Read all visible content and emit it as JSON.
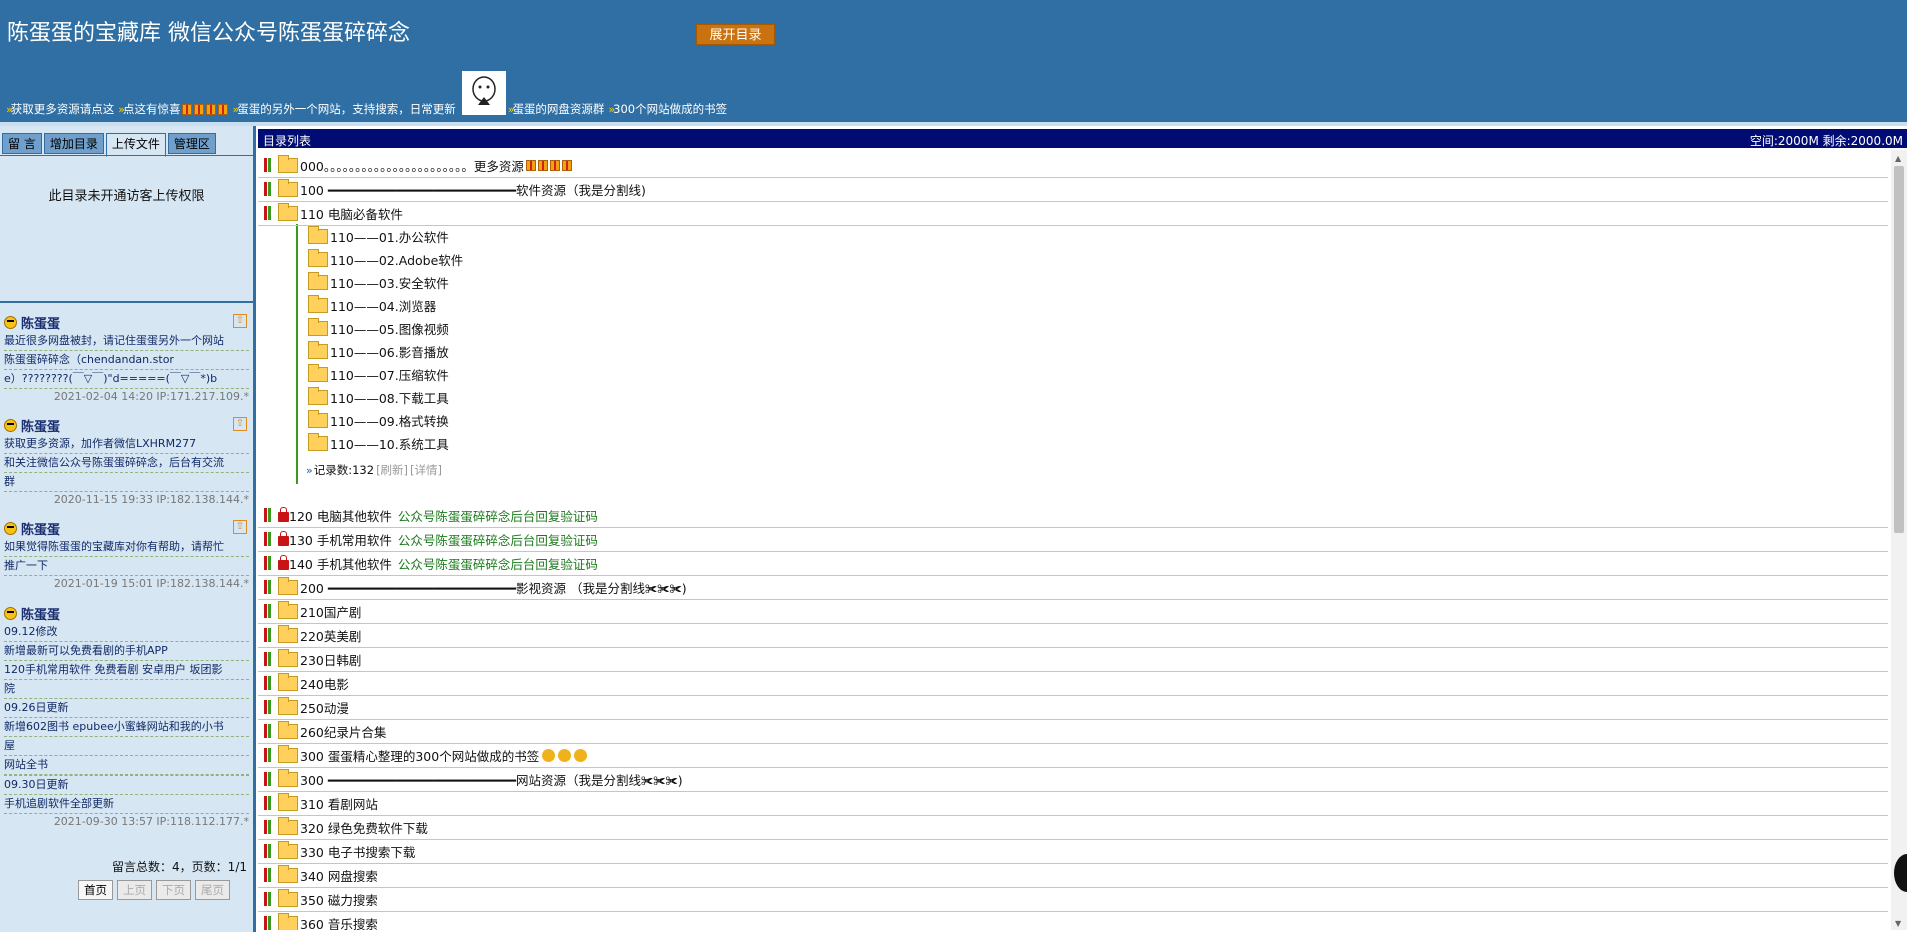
{
  "header": {
    "title": "陈蛋蛋的宝藏库 微信公众号陈蛋蛋碎碎念",
    "expand_button": "展开目录",
    "links": [
      {
        "text": "获取更多资源请点这"
      },
      {
        "text": "点这有惊喜"
      },
      {
        "text": "蛋蛋的另外一个网站，支持搜索，日常更新"
      },
      {
        "text": "蛋蛋的网盘资源群"
      },
      {
        "text": "300个网站做成的书签"
      }
    ]
  },
  "tabs": [
    {
      "label": "留 言",
      "active": false
    },
    {
      "label": "增加目录",
      "active": false
    },
    {
      "label": "上传文件",
      "active": true
    },
    {
      "label": "管理区",
      "active": false
    }
  ],
  "upload_panel": {
    "message": "此目录未开通访客上传权限"
  },
  "messages": [
    {
      "author": "陈蛋蛋",
      "lines": [
        "最近很多网盘被封，请记住蛋蛋另外一个网站",
        "陈蛋蛋碎碎念（chendandan.stor",
        "e）????????(￣▽￣)\"d=====(￣▽￣*)b"
      ],
      "meta": "2021-02-04 14:20 IP:171.217.109.*"
    },
    {
      "author": "陈蛋蛋",
      "lines": [
        "获取更多资源，加作者微信LXHRM277",
        "和关注微信公众号陈蛋蛋碎碎念，后台有交流",
        "群"
      ],
      "meta": "2020-11-15 19:33 IP:182.138.144.*"
    },
    {
      "author": "陈蛋蛋",
      "lines": [
        "如果觉得陈蛋蛋的宝藏库对你有帮助，请帮忙",
        "推广一下"
      ],
      "meta": "2021-01-19 15:01 IP:182.138.144.*"
    },
    {
      "author": "陈蛋蛋",
      "lines": [
        "09.12修改",
        "新增最新可以免费看剧的手机APP",
        "120手机常用软件 免费看剧 安卓用户 坂团影",
        "院",
        "09.26日更新",
        "新增602图书 epubee小蜜蜂网站和我的小书",
        "屋",
        "网站全书",
        "",
        "09.30日更新",
        "手机追剧软件全部更新"
      ],
      "meta": "2021-09-30 13:57 IP:118.112.177.*"
    }
  ],
  "pager": {
    "summary": "留言总数：4，页数：1/1",
    "buttons": [
      "首页",
      "上页",
      "下页",
      "尾页"
    ]
  },
  "list": {
    "title": "目录列表",
    "space": "空间:2000M 剩余:2000.0M",
    "rows": [
      {
        "name": "000。。。。。。。。。。。。。。。。。。。。。。。更多资源",
        "note": "",
        "locked": false
      },
      {
        "name": "100 ━━━━━━━━━━━━━━━━━━━━━━━━━软件资源（我是分割线)",
        "note": "",
        "locked": false
      },
      {
        "name": "110 电脑必备软件",
        "note": "",
        "locked": false
      },
      {
        "name": "120 电脑其他软件",
        "note": "公众号陈蛋蛋碎碎念后台回复验证码",
        "locked": true
      },
      {
        "name": "130 手机常用软件",
        "note": "公众号陈蛋蛋碎碎念后台回复验证码",
        "locked": true
      },
      {
        "name": "140 手机其他软件",
        "note": "公众号陈蛋蛋碎碎念后台回复验证码",
        "locked": true
      },
      {
        "name": "200 ━━━━━━━━━━━━━━━━━━━━━━━━━影视资源 （我是分割线✀✀✀)",
        "note": "",
        "locked": false
      },
      {
        "name": "210国产剧",
        "note": "",
        "locked": false
      },
      {
        "name": "220英美剧",
        "note": "",
        "locked": false
      },
      {
        "name": "230日韩剧",
        "note": "",
        "locked": false
      },
      {
        "name": "240电影",
        "note": "",
        "locked": false
      },
      {
        "name": "250动漫",
        "note": "",
        "locked": false
      },
      {
        "name": "260纪录片合集",
        "note": "",
        "locked": false
      },
      {
        "name": "300 蛋蛋精心整理的300个网站做成的书签",
        "note": "",
        "locked": false
      },
      {
        "name": "300 ━━━━━━━━━━━━━━━━━━━━━━━━━网站资源（我是分割线✀✀✀)",
        "note": "",
        "locked": false
      },
      {
        "name": "310 看剧网站",
        "note": "",
        "locked": false
      },
      {
        "name": "320 绿色免费软件下载",
        "note": "",
        "locked": false
      },
      {
        "name": "330 电子书搜索下载",
        "note": "",
        "locked": false
      },
      {
        "name": "340 网盘搜索",
        "note": "",
        "locked": false
      },
      {
        "name": "350 磁力搜索",
        "note": "",
        "locked": false
      },
      {
        "name": "360 音乐搜索",
        "note": "",
        "locked": false
      }
    ],
    "subfolders": [
      "110——01.办公软件",
      "110——02.Adobe软件",
      "110——03.安全软件",
      "110——04.浏览器",
      "110——05.图像视频",
      "110——06.影音播放",
      "110——07.压缩软件",
      "110——08.下载工具",
      "110——09.格式转换",
      "110——10.系统工具"
    ],
    "record": {
      "count": "记录数:132",
      "refresh": "[刷新]",
      "detail": "[详情]"
    }
  }
}
